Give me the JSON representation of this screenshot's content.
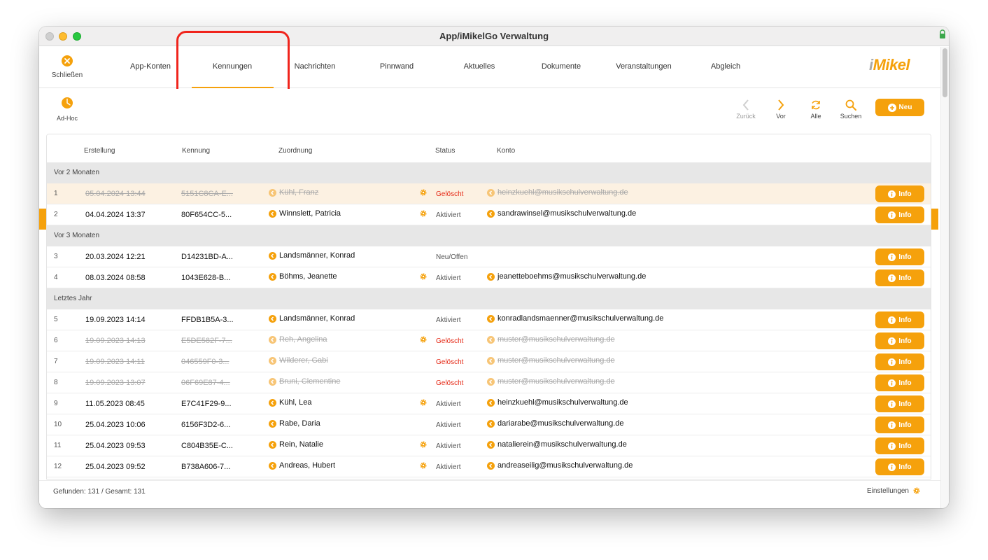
{
  "window": {
    "title": "App/iMikelGo Verwaltung"
  },
  "nav": {
    "close_label": "Schließen",
    "tabs": [
      {
        "label": "App-Konten"
      },
      {
        "label": "Kennungen"
      },
      {
        "label": "Nachrichten"
      },
      {
        "label": "Pinnwand"
      },
      {
        "label": "Aktuelles"
      },
      {
        "label": "Dokumente"
      },
      {
        "label": "Veranstaltungen"
      },
      {
        "label": "Abgleich"
      }
    ],
    "active_tab": "Kennungen",
    "logo": {
      "prefix": "i",
      "text": "Mikel"
    }
  },
  "toolbar": {
    "adhoc_label": "Ad-Hoc",
    "back_label": "Zurück",
    "forward_label": "Vor",
    "all_label": "Alle",
    "search_label": "Suchen",
    "new_label": "Neu"
  },
  "table": {
    "headers": {
      "erstellung": "Erstellung",
      "kennung": "Kennung",
      "zuordnung": "Zuordnung",
      "status": "Status",
      "konto": "Konto"
    },
    "info_label": "Info",
    "groups": [
      {
        "label": "Vor 2 Monaten",
        "rows": [
          {
            "n": "1",
            "date": "05.04.2024 13:44",
            "kennung": "5151C8CA-E...",
            "name": "Kühl, Franz",
            "gear": true,
            "status": "Gelöscht",
            "konto": "heinzkuehl@musikschulverwaltung.de",
            "deleted": true,
            "selected": true
          },
          {
            "n": "2",
            "date": "04.04.2024 13:37",
            "kennung": "80F654CC-5...",
            "name": "Winnslett, Patricia",
            "gear": true,
            "status": "Aktiviert",
            "konto": "sandrawinsel@musikschulverwaltung.de",
            "deleted": false
          }
        ]
      },
      {
        "label": "Vor 3 Monaten",
        "rows": [
          {
            "n": "3",
            "date": "20.03.2024 12:21",
            "kennung": "D14231BD-A...",
            "name": "Landsmänner, Konrad",
            "gear": false,
            "status": "Neu/Offen",
            "konto": "",
            "deleted": false
          },
          {
            "n": "4",
            "date": "08.03.2024 08:58",
            "kennung": "1043E628-B...",
            "name": "Böhms, Jeanette",
            "gear": true,
            "status": "Aktiviert",
            "konto": "jeanetteboehms@musikschulverwaltung.de",
            "deleted": false
          }
        ]
      },
      {
        "label": "Letztes Jahr",
        "rows": [
          {
            "n": "5",
            "date": "19.09.2023 14:14",
            "kennung": "FFDB1B5A-3...",
            "name": "Landsmänner, Konrad",
            "gear": false,
            "status": "Aktiviert",
            "konto": "konradlandsmaenner@musikschulverwaltung.de",
            "deleted": false
          },
          {
            "n": "6",
            "date": "19.09.2023 14:13",
            "kennung": "E5DE582F-7...",
            "name": "Reh, Angelina",
            "gear": true,
            "status": "Gelöscht",
            "konto": "muster@musikschulverwaltung.de",
            "deleted": true
          },
          {
            "n": "7",
            "date": "19.09.2023 14:11",
            "kennung": "046559F0-3...",
            "name": "Wilderer, Gabi",
            "gear": false,
            "status": "Gelöscht",
            "konto": "muster@musikschulverwaltung.de",
            "deleted": true
          },
          {
            "n": "8",
            "date": "19.09.2023 13:07",
            "kennung": "06F69E87-4...",
            "name": "Bruni, Clementine",
            "gear": false,
            "status": "Gelöscht",
            "konto": "muster@musikschulverwaltung.de",
            "deleted": true
          },
          {
            "n": "9",
            "date": "11.05.2023 08:45",
            "kennung": "E7C41F29-9...",
            "name": "Kühl, Lea",
            "gear": true,
            "status": "Aktiviert",
            "konto": "heinzkuehl@musikschulverwaltung.de",
            "deleted": false
          },
          {
            "n": "10",
            "date": "25.04.2023 10:06",
            "kennung": "6156F3D2-6...",
            "name": "Rabe, Daria",
            "gear": false,
            "status": "Aktiviert",
            "konto": "dariarabe@musikschulverwaltung.de",
            "deleted": false
          },
          {
            "n": "11",
            "date": "25.04.2023 09:53",
            "kennung": "C804B35E-C...",
            "name": "Rein, Natalie",
            "gear": true,
            "status": "Aktiviert",
            "konto": "natalierein@musikschulverwaltung.de",
            "deleted": false
          },
          {
            "n": "12",
            "date": "25.04.2023 09:52",
            "kennung": "B738A606-7...",
            "name": "Andreas, Hubert",
            "gear": true,
            "status": "Aktiviert",
            "konto": "andreaseilig@musikschulverwaltung.de",
            "deleted": false
          }
        ]
      }
    ]
  },
  "footer": {
    "count_text": "Gefunden: 131 / Gesamt: 131",
    "settings_label": "Einstellungen"
  },
  "colors": {
    "accent": "#f5a10c",
    "deleted": "#e52a17",
    "highlight": "#f0241c",
    "selected_row": "#fcf1e2",
    "group_bg": "#e7e7e7"
  }
}
